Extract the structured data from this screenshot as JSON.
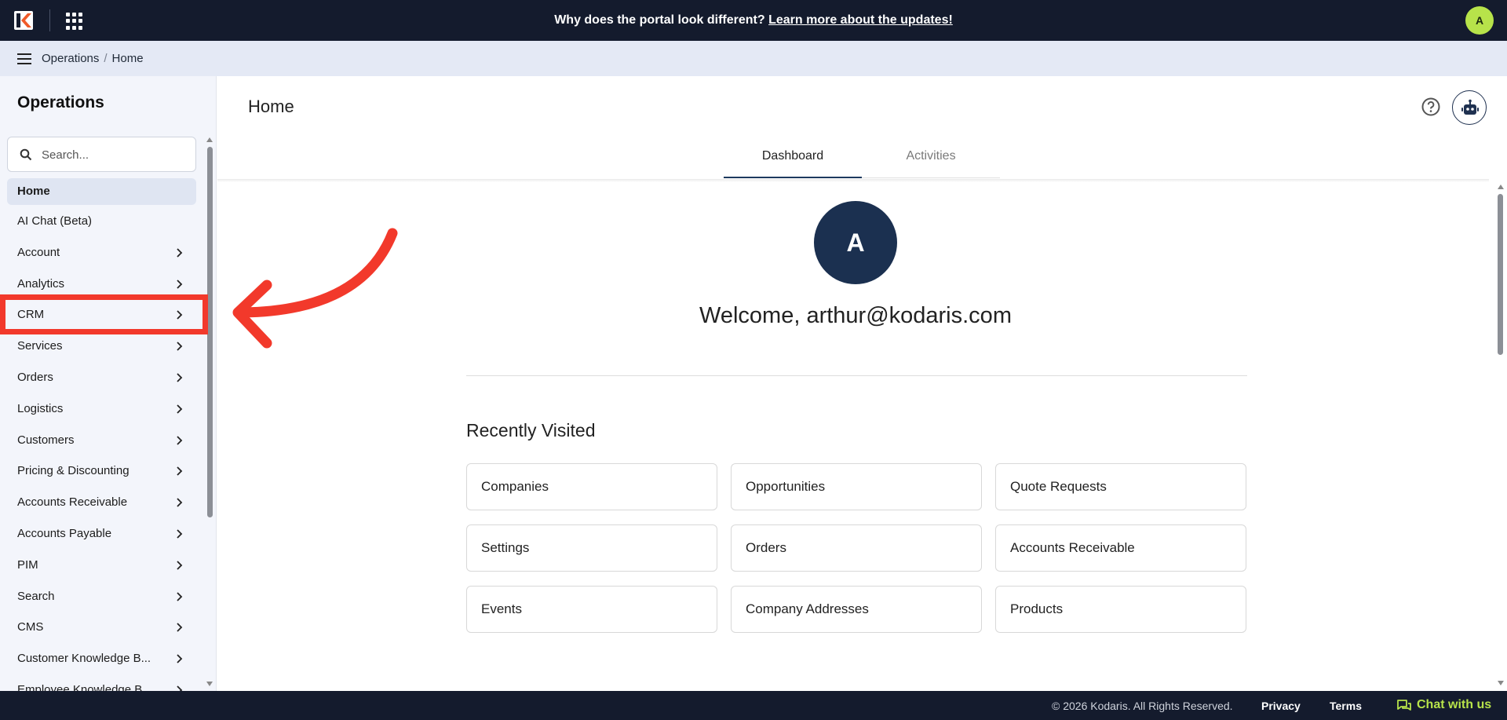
{
  "banner": {
    "text": "Why does the portal look different? ",
    "link": "Learn more about the updates!"
  },
  "user": {
    "initial": "A"
  },
  "breadcrumb": {
    "parent": "Operations",
    "separator": "/",
    "current": "Home"
  },
  "sidebar": {
    "title": "Operations",
    "search_placeholder": "Search...",
    "items": [
      {
        "label": "Home"
      },
      {
        "label": "AI Chat (Beta)"
      },
      {
        "label": "Account"
      },
      {
        "label": "Analytics"
      },
      {
        "label": "CRM"
      },
      {
        "label": "Services"
      },
      {
        "label": "Orders"
      },
      {
        "label": "Logistics"
      },
      {
        "label": "Customers"
      },
      {
        "label": "Pricing & Discounting"
      },
      {
        "label": "Accounts Receivable"
      },
      {
        "label": "Accounts Payable"
      },
      {
        "label": "PIM"
      },
      {
        "label": "Search"
      },
      {
        "label": "CMS"
      },
      {
        "label": "Customer Knowledge B..."
      },
      {
        "label": "Employee Knowledge B..."
      }
    ]
  },
  "main": {
    "title": "Home",
    "tabs": [
      {
        "label": "Dashboard"
      },
      {
        "label": "Activities"
      }
    ],
    "avatar_initial": "A",
    "welcome": "Welcome, arthur@kodaris.com",
    "recent_title": "Recently Visited",
    "recent": [
      {
        "label": "Companies"
      },
      {
        "label": "Opportunities"
      },
      {
        "label": "Quote Requests"
      },
      {
        "label": "Settings"
      },
      {
        "label": "Orders"
      },
      {
        "label": "Accounts Receivable"
      },
      {
        "label": "Events"
      },
      {
        "label": "Company Addresses"
      },
      {
        "label": "Products"
      }
    ]
  },
  "footer": {
    "copyright": "© 2026 Kodaris. All Rights Reserved.",
    "privacy": "Privacy",
    "terms": "Terms",
    "chat": "Chat with us"
  },
  "colors": {
    "accent": "#b7e34a",
    "dark": "#141b2d",
    "annotation": "#f2392b",
    "avatar_bg": "#1b3050"
  }
}
